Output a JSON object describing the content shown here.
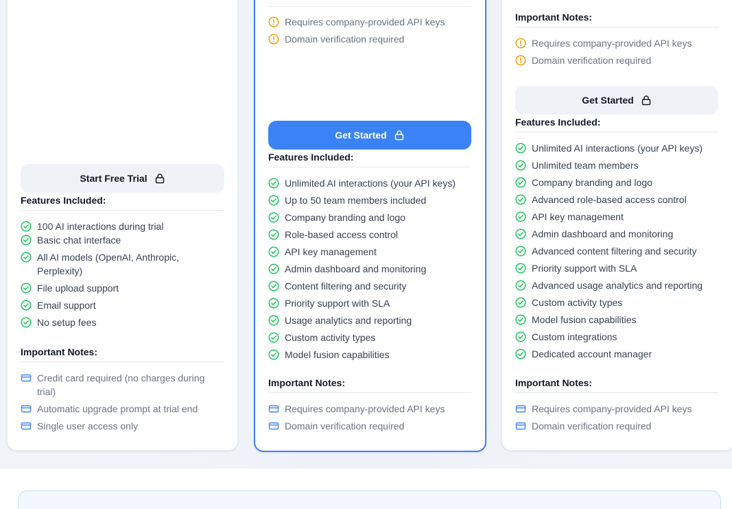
{
  "left_card": {
    "button_label": "Start Free Trial",
    "features_title": "Features Included:",
    "features": [
      "100 AI interactions during trial",
      "Basic chat interface",
      "All AI models (OpenAI, Anthropic, Perplexity)",
      "File upload support",
      "Email support",
      "No setup fees"
    ],
    "notes_title": "Important Notes:",
    "notes": [
      "Credit card required (no charges during trial)",
      "Automatic upgrade prompt at trial end",
      "Single user access only"
    ]
  },
  "mid_card": {
    "warnings": [
      "Requires company-provided API keys",
      "Domain verification required"
    ],
    "button_label": "Get Started",
    "features_title": "Features Included:",
    "features": [
      "Unlimited AI interactions (your API keys)",
      "Up to 50 team members included",
      "Company branding and logo",
      "Role-based access control",
      "API key management",
      "Admin dashboard and monitoring",
      "Content filtering and security",
      "Priority support with SLA",
      "Usage analytics and reporting",
      "Custom activity types",
      "Model fusion capabilities"
    ],
    "notes_title": "Important Notes:",
    "notes": [
      "Requires company-provided API keys",
      "Domain verification required"
    ]
  },
  "right_card": {
    "top_notes_title": "Important Notes:",
    "warnings": [
      "Requires company-provided API keys",
      "Domain verification required"
    ],
    "button_label": "Get Started",
    "features_title": "Features Included:",
    "features": [
      "Unlimited AI interactions (your API keys)",
      "Unlimited team members",
      "Company branding and logo",
      "Advanced role-based access control",
      "API key management",
      "Admin dashboard and monitoring",
      "Advanced content filtering and security",
      "Priority support with SLA",
      "Advanced usage analytics and reporting",
      "Custom activity types",
      "Model fusion capabilities",
      "Custom integrations",
      "Dedicated account manager"
    ],
    "notes_title": "Important Notes:",
    "notes": [
      "Requires company-provided API keys",
      "Domain verification required"
    ]
  },
  "colors": {
    "accent": "#3b82f6",
    "check": "#22c55e",
    "warning": "#f59e0b",
    "note_icon": "#3b82f6"
  },
  "icons": {
    "feature": "check-circle-icon",
    "warning": "alert-circle-icon",
    "note": "credit-card-icon",
    "button": "lock-icon"
  }
}
